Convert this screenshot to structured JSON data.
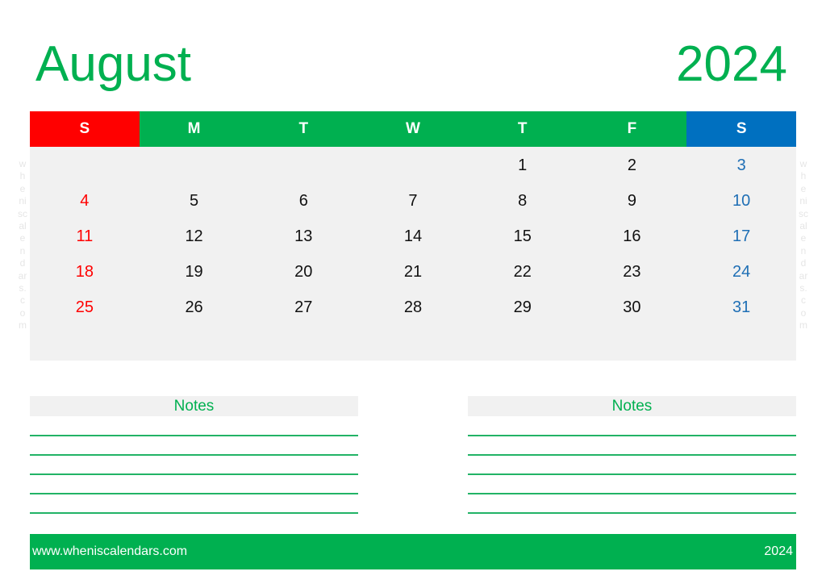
{
  "title": {
    "month": "August",
    "year": "2024"
  },
  "colors": {
    "accent": "#00b050",
    "sunday": "#ff0000",
    "saturday": "#0070c0",
    "grid_bg": "#f1f1f1"
  },
  "weekdays": [
    {
      "label": "S",
      "color": "#ff0000"
    },
    {
      "label": "M",
      "color": "#00b050"
    },
    {
      "label": "T",
      "color": "#00b050"
    },
    {
      "label": "W",
      "color": "#00b050"
    },
    {
      "label": "T",
      "color": "#00b050"
    },
    {
      "label": "F",
      "color": "#00b050"
    },
    {
      "label": "S",
      "color": "#0070c0"
    }
  ],
  "weeks": [
    [
      "",
      "",
      "",
      "",
      "1",
      "2",
      "3"
    ],
    [
      "4",
      "5",
      "6",
      "7",
      "8",
      "9",
      "10"
    ],
    [
      "11",
      "12",
      "13",
      "14",
      "15",
      "16",
      "17"
    ],
    [
      "18",
      "19",
      "20",
      "21",
      "22",
      "23",
      "24"
    ],
    [
      "25",
      "26",
      "27",
      "28",
      "29",
      "30",
      "31"
    ],
    [
      "",
      "",
      "",
      "",
      "",
      "",
      ""
    ]
  ],
  "watermark": "wheniscalendars.com",
  "notes": [
    {
      "title": "Notes",
      "lines": 5
    },
    {
      "title": "Notes",
      "lines": 5
    }
  ],
  "footer": {
    "website": "www.wheniscalendars.com",
    "year": "2024"
  }
}
